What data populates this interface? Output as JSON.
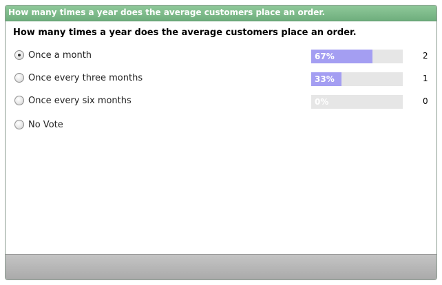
{
  "title": "How many times a year does the average customers place an order.",
  "question": "How many times a year does the average customers place an order.",
  "options": [
    {
      "label": "Once a month",
      "percent_label": "67%",
      "percent": 67,
      "count": "2",
      "selected": true
    },
    {
      "label": "Once every three months",
      "percent_label": "33%",
      "percent": 33,
      "count": "1",
      "selected": false
    },
    {
      "label": "Once every six months",
      "percent_label": "0%",
      "percent": 0,
      "count": "0",
      "selected": false
    },
    {
      "label": "No Vote",
      "selected": false
    }
  ],
  "colors": {
    "titlebar": "#7fbb8b",
    "bar_fill": "#a49ef2",
    "bar_track": "#e6e6e6",
    "footer": "#b8b8b8"
  }
}
